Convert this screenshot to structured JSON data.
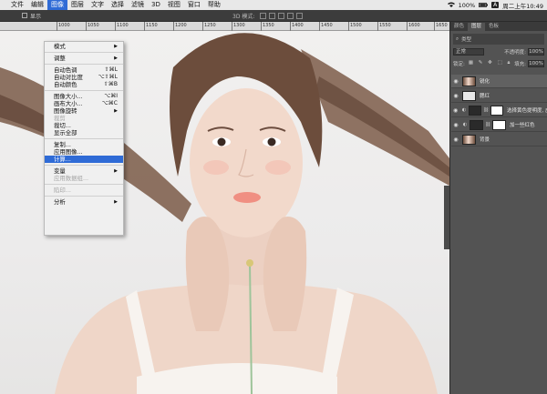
{
  "menubar": {
    "items": [
      "文件",
      "编辑",
      "图像",
      "图层",
      "文字",
      "选择",
      "滤镜",
      "3D",
      "视图",
      "窗口",
      "帮助"
    ],
    "active_index": 2,
    "battery": "100%",
    "input_badge": "A",
    "clock": "周二上午10:49"
  },
  "optbar": {
    "show_label": "显示",
    "mode_label": "3D 模式:"
  },
  "ruler": {
    "ticks": [
      "1000",
      "1050",
      "1100",
      "1150",
      "1200",
      "1250",
      "1300",
      "1350",
      "1400",
      "1450",
      "1500",
      "1550",
      "1600",
      "1650"
    ]
  },
  "image_menu": {
    "items": [
      {
        "label": "模式",
        "shortcut": "",
        "submenu": true,
        "disabled": false,
        "selected": false
      },
      {
        "sep": true
      },
      {
        "label": "调整",
        "shortcut": "",
        "submenu": true,
        "disabled": false,
        "selected": false
      },
      {
        "sep": true
      },
      {
        "label": "自动色调",
        "shortcut": "⇧⌘L",
        "submenu": false,
        "disabled": false,
        "selected": false
      },
      {
        "label": "自动对比度",
        "shortcut": "⌥⇧⌘L",
        "submenu": false,
        "disabled": false,
        "selected": false
      },
      {
        "label": "自动颜色",
        "shortcut": "⇧⌘B",
        "submenu": false,
        "disabled": false,
        "selected": false
      },
      {
        "sep": true
      },
      {
        "label": "图像大小...",
        "shortcut": "⌥⌘I",
        "submenu": false,
        "disabled": false,
        "selected": false
      },
      {
        "label": "画布大小...",
        "shortcut": "⌥⌘C",
        "submenu": false,
        "disabled": false,
        "selected": false
      },
      {
        "label": "图像旋转",
        "shortcut": "",
        "submenu": true,
        "disabled": false,
        "selected": false
      },
      {
        "label": "裁剪",
        "shortcut": "",
        "submenu": false,
        "disabled": true,
        "selected": false
      },
      {
        "label": "裁切...",
        "shortcut": "",
        "submenu": false,
        "disabled": false,
        "selected": false
      },
      {
        "label": "显示全部",
        "shortcut": "",
        "submenu": false,
        "disabled": false,
        "selected": false
      },
      {
        "sep": true
      },
      {
        "label": "复制...",
        "shortcut": "",
        "submenu": false,
        "disabled": false,
        "selected": false
      },
      {
        "label": "应用图像...",
        "shortcut": "",
        "submenu": false,
        "disabled": false,
        "selected": false
      },
      {
        "label": "计算...",
        "shortcut": "",
        "submenu": false,
        "disabled": false,
        "selected": true
      },
      {
        "sep": true
      },
      {
        "label": "变量",
        "shortcut": "",
        "submenu": true,
        "disabled": false,
        "selected": false
      },
      {
        "label": "应用数据组...",
        "shortcut": "",
        "submenu": false,
        "disabled": true,
        "selected": false
      },
      {
        "sep": true
      },
      {
        "label": "陷印...",
        "shortcut": "",
        "submenu": false,
        "disabled": true,
        "selected": false
      },
      {
        "sep": true
      },
      {
        "label": "分析",
        "shortcut": "",
        "submenu": true,
        "disabled": false,
        "selected": false
      }
    ]
  },
  "panel": {
    "tabs": [
      "颜色",
      "图层",
      "色板"
    ],
    "active_tab": 1,
    "search_label": "类型",
    "blend_mode": "正常",
    "opacity_label": "不透明度:",
    "opacity_value": "100%",
    "lock_label": "锁定:",
    "fill_label": "填充:",
    "fill_value": "100%",
    "layers": [
      {
        "name": "锐化",
        "kind": "photo",
        "mask": false,
        "selected": true
      },
      {
        "name": "腮红",
        "kind": "blank",
        "mask": false,
        "selected": false
      },
      {
        "name": "选择黄色提明度, 皮",
        "kind": "adjust",
        "mask": true,
        "selected": false
      },
      {
        "name": "加一些红色",
        "kind": "adjust",
        "mask": true,
        "selected": false
      },
      {
        "name": "背景",
        "kind": "photo",
        "mask": false,
        "selected": false
      }
    ]
  },
  "colors": {
    "menu_highlight": "#2f6bd6",
    "panel_bg": "#535353"
  }
}
